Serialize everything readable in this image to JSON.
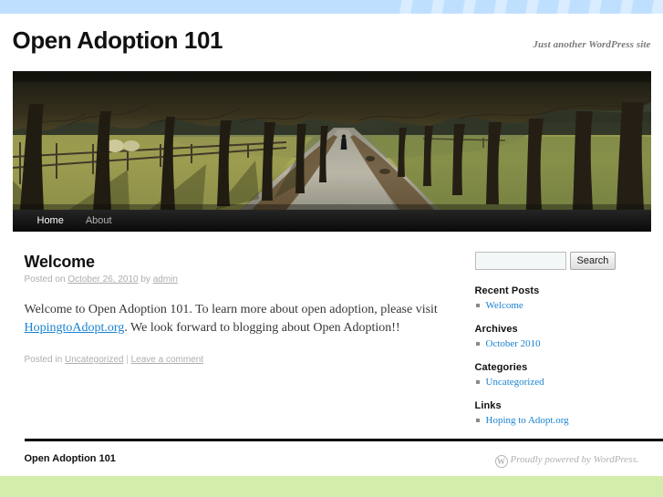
{
  "site": {
    "title": "Open Adoption 101",
    "description": "Just another WordPress site"
  },
  "nav": {
    "items": [
      {
        "label": "Home",
        "current": true
      },
      {
        "label": "About",
        "current": false
      }
    ]
  },
  "post": {
    "title": "Welcome",
    "meta_prefix": "Posted on ",
    "date": "October 26, 2010",
    "meta_by": " by ",
    "author": "admin",
    "body_before_link": "Welcome to Open Adoption 101.  To learn more about open adoption, please visit ",
    "body_link": "HopingtoAdopt.org",
    "body_after_link": ".  We look forward to blogging about Open Adoption!!",
    "utility_prefix": "Posted in ",
    "category": "Uncategorized",
    "utility_sep": " | ",
    "comments": "Leave a comment"
  },
  "search": {
    "value": "",
    "placeholder": "",
    "button_label": "Search"
  },
  "widgets": [
    {
      "title": "Recent Posts",
      "items": [
        "Welcome"
      ]
    },
    {
      "title": "Archives",
      "items": [
        "October 2010"
      ]
    },
    {
      "title": "Categories",
      "items": [
        "Uncategorized"
      ]
    },
    {
      "title": "Links",
      "items": [
        "Hoping to Adopt.org"
      ]
    }
  ],
  "footer": {
    "site_title": "Open Adoption 101",
    "generator_mark": "W",
    "generator_text": "Proudly powered by WordPress."
  },
  "colors": {
    "top_band": "#bfdfff",
    "bottom_band": "#d3eeab",
    "link": "#1982d1",
    "meta": "#adadad",
    "nav_background": "#000000"
  }
}
